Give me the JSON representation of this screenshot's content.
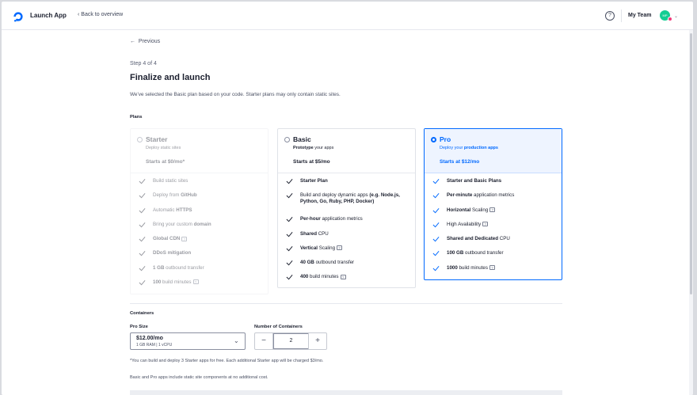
{
  "header": {
    "app_title": "Launch App",
    "back_label": "Back to overview",
    "help_icon": "?",
    "team_name": "My Team",
    "avatar_initials": "MP"
  },
  "nav": {
    "previous_label": "Previous"
  },
  "page": {
    "step": "Step 4 of 4",
    "title": "Finalize and launch",
    "description": "We've selected the Basic plan based on your code. Starter plans may only contain static sites.",
    "plans_label": "Plans"
  },
  "plans": [
    {
      "name": "Starter",
      "subtitle": "Deploy static sites",
      "price": "Starts at $0/mo*",
      "selected": false,
      "disabled": true,
      "features": [
        [
          {
            "t": "Build static sites",
            "b": false
          }
        ],
        [
          {
            "t": "Deploy from ",
            "b": false
          },
          {
            "t": "GitHub",
            "b": true
          }
        ],
        [
          {
            "t": "Automatic ",
            "b": false
          },
          {
            "t": "HTTPS",
            "b": true
          }
        ],
        [
          {
            "t": "Bring your custom ",
            "b": false
          },
          {
            "t": "domain",
            "b": true
          }
        ],
        [
          {
            "t": "Global CDN",
            "b": true
          }
        ],
        [
          {
            "t": "DDoS mitigation",
            "b": true
          }
        ],
        [
          {
            "t": "1 GB",
            "b": true
          },
          {
            "t": " outbound transfer",
            "b": false
          }
        ],
        [
          {
            "t": "100",
            "b": true
          },
          {
            "t": " build minutes",
            "b": false
          }
        ]
      ],
      "help_on": [
        4,
        7
      ]
    },
    {
      "name": "Basic",
      "subtitle_parts": [
        {
          "t": "Prototype",
          "b": true
        },
        {
          "t": " your apps",
          "b": false
        }
      ],
      "price": "Starts at $5/mo",
      "selected": false,
      "features": [
        [
          {
            "t": "Starter Plan",
            "b": true
          }
        ],
        [
          {
            "t": "Build and deploy dynamic apps ",
            "b": false
          },
          {
            "t": "(e.g. Node.js, Python, Go, Ruby, PHP, Docker)",
            "b": true
          }
        ],
        [
          {
            "t": "Per-hour",
            "b": true
          },
          {
            "t": " application metrics",
            "b": false
          }
        ],
        [
          {
            "t": "Shared",
            "b": true
          },
          {
            "t": " CPU",
            "b": false
          }
        ],
        [
          {
            "t": "Vertical",
            "b": true
          },
          {
            "t": " Scaling",
            "b": false
          }
        ],
        [
          {
            "t": "40 GB",
            "b": true
          },
          {
            "t": " outbound transfer",
            "b": false
          }
        ],
        [
          {
            "t": "400",
            "b": true
          },
          {
            "t": " build minutes",
            "b": false
          }
        ]
      ],
      "help_on": [
        4,
        6
      ]
    },
    {
      "name": "Pro",
      "subtitle_parts": [
        {
          "t": "Deploy your ",
          "b": false
        },
        {
          "t": "production apps",
          "b": true
        }
      ],
      "price": "Starts at $12/mo",
      "selected": true,
      "features": [
        [
          {
            "t": "Starter and Basic Plans",
            "b": true
          }
        ],
        [
          {
            "t": "Per-minute",
            "b": true
          },
          {
            "t": " application metrics",
            "b": false
          }
        ],
        [
          {
            "t": "Horizontal",
            "b": true
          },
          {
            "t": " Scaling",
            "b": false
          }
        ],
        [
          {
            "t": "High Availability",
            "b": false
          }
        ],
        [
          {
            "t": "Shared and Dedicated",
            "b": true
          },
          {
            "t": " CPU",
            "b": false
          }
        ],
        [
          {
            "t": "100 GB",
            "b": true
          },
          {
            "t": " outbound transfer",
            "b": false
          }
        ],
        [
          {
            "t": "1000",
            "b": true
          },
          {
            "t": " build minutes",
            "b": false
          }
        ]
      ],
      "help_on": [
        2,
        3,
        6
      ]
    }
  ],
  "containers": {
    "section_label": "Containers",
    "size_label": "Pro Size",
    "size_value": "$12.00/mo",
    "size_spec": "1 GB RAM | 1 vCPU",
    "count_label": "Number of Containers",
    "count_value": "2",
    "minus": "−",
    "plus": "+",
    "note_1": "*You can build and deploy 3 Starter apps for free. Each additional Starter app will be charged $3/mo.",
    "note_2": "Basic and Pro apps include static site components at no additional cost."
  },
  "colors": {
    "accent": "#0069ff",
    "avatar": "#15cd93"
  }
}
